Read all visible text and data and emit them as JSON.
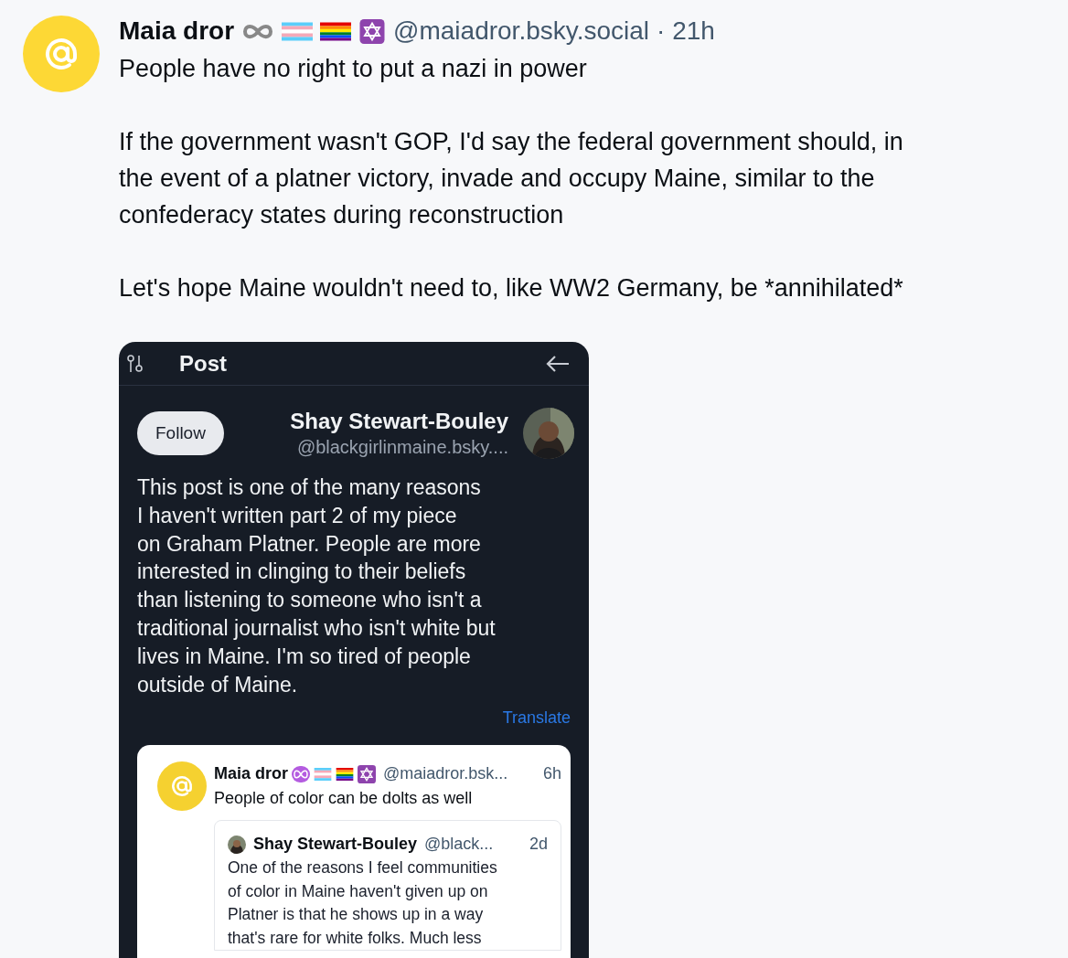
{
  "post": {
    "author": {
      "name": "Maia dror",
      "handle": "@maiadror.bsky.social",
      "time": "· 21h"
    },
    "paragraphs": [
      "People have no right to put a nazi in power",
      "If the government wasn't GOP, I'd say the federal government should, in\nthe event of a platner victory, invade and occupy Maine, similar to the\nconfederacy states during reconstruction",
      "Let's hope Maine wouldn't need to, like WW2 Germany, be *annihilated*"
    ],
    "embed": {
      "header_title": "Post",
      "follow_label": "Follow",
      "author_name": "Shay Stewart-Bouley",
      "author_handle": "@blackgirlinmaine.bsky....",
      "text": "This post is one of the many reasons\nI haven't written part 2 of my piece\non Graham Platner. People are more\ninterested in clinging to their beliefs\nthan listening to someone who isn't a\ntraditional journalist who isn't white but\nlives in Maine. I'm so tired of people\noutside of Maine.",
      "translate": "Translate",
      "quote": {
        "name": "Maia dror",
        "handle": "@maiadror.bsk...",
        "time": "6h",
        "text": "People of color can be dolts as well",
        "nested": {
          "name": "Shay Stewart-Bouley",
          "handle": "@black...",
          "time": "2d",
          "text": "One of the reasons I feel communities\nof color in Maine haven't given up on\nPlatner is that he shows up in a way\nthat's rare for white folks. Much less"
        }
      }
    }
  }
}
